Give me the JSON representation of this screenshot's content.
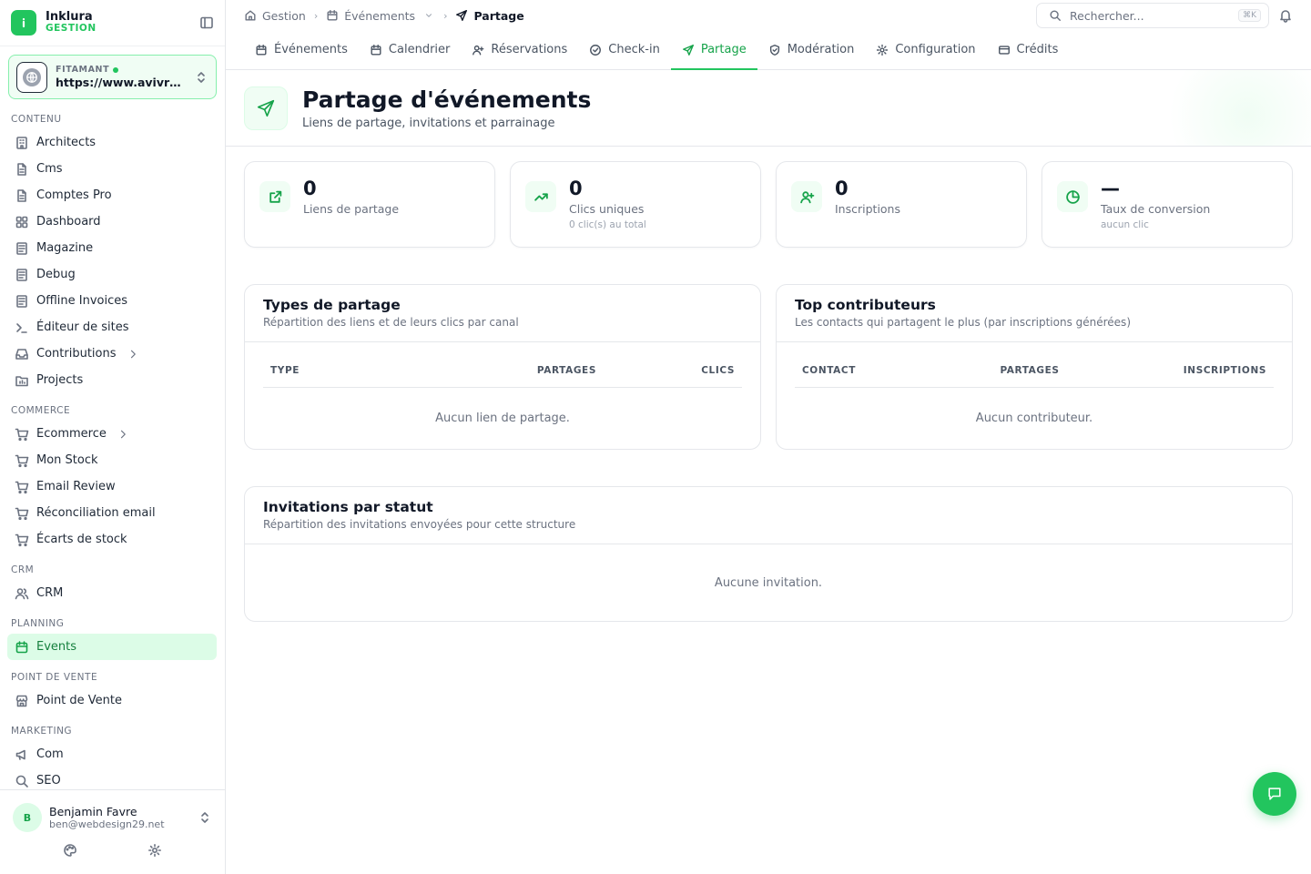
{
  "brand": {
    "name": "Inklura",
    "sub": "GESTION"
  },
  "site": {
    "label": "FITAMANT",
    "url": "https://www.avivrance.fr"
  },
  "nav": {
    "sections": [
      {
        "title": "CONTENU",
        "items": [
          {
            "label": "Architects"
          },
          {
            "label": "Cms"
          },
          {
            "label": "Comptes Pro"
          },
          {
            "label": "Dashboard"
          },
          {
            "label": "Magazine"
          },
          {
            "label": "Debug"
          },
          {
            "label": "Offline Invoices"
          },
          {
            "label": "Éditeur de sites"
          },
          {
            "label": "Contributions"
          },
          {
            "label": "Projects"
          }
        ]
      },
      {
        "title": "COMMERCE",
        "items": [
          {
            "label": "Ecommerce"
          },
          {
            "label": "Mon Stock"
          },
          {
            "label": "Email Review"
          },
          {
            "label": "Réconciliation email"
          },
          {
            "label": "Écarts de stock"
          }
        ]
      },
      {
        "title": "CRM",
        "items": [
          {
            "label": "CRM"
          }
        ]
      },
      {
        "title": "PLANNING",
        "items": [
          {
            "label": "Events"
          }
        ]
      },
      {
        "title": "POINT DE VENTE",
        "items": [
          {
            "label": "Point de Vente"
          }
        ]
      },
      {
        "title": "MARKETING",
        "items": [
          {
            "label": "Com"
          },
          {
            "label": "SEO"
          }
        ]
      }
    ]
  },
  "user": {
    "initial": "B",
    "name": "Benjamin Favre",
    "email": "ben@webdesign29.net"
  },
  "breadcrumb": {
    "home": "Gestion",
    "section": "Événements",
    "current": "Partage"
  },
  "search": {
    "placeholder": "Rechercher...",
    "shortcut": "⌘K"
  },
  "tabs": [
    {
      "label": "Événements"
    },
    {
      "label": "Calendrier"
    },
    {
      "label": "Réservations"
    },
    {
      "label": "Check-in"
    },
    {
      "label": "Partage"
    },
    {
      "label": "Modération"
    },
    {
      "label": "Configuration"
    },
    {
      "label": "Crédits"
    }
  ],
  "page": {
    "title": "Partage d'événements",
    "subtitle": "Liens de partage, invitations et parrainage"
  },
  "stats": [
    {
      "value": "0",
      "label": "Liens de partage",
      "sub": ""
    },
    {
      "value": "0",
      "label": "Clics uniques",
      "sub": "0 clic(s) au total"
    },
    {
      "value": "0",
      "label": "Inscriptions",
      "sub": ""
    },
    {
      "value": "—",
      "label": "Taux de conversion",
      "sub": "aucun clic"
    }
  ],
  "types": {
    "title": "Types de partage",
    "subtitle": "Répartition des liens et de leurs clics par canal",
    "columns": [
      "TYPE",
      "PARTAGES",
      "CLICS"
    ],
    "empty": "Aucun lien de partage."
  },
  "contributors": {
    "title": "Top contributeurs",
    "subtitle": "Les contacts qui partagent le plus (par inscriptions générées)",
    "columns": [
      "CONTACT",
      "PARTAGES",
      "INSCRIPTIONS"
    ],
    "empty": "Aucun contributeur."
  },
  "invitations": {
    "title": "Invitations par statut",
    "subtitle": "Répartition des invitations envoyées pour cette structure",
    "empty": "Aucune invitation."
  },
  "colors": {
    "accent": "#22c55e",
    "accent_dark": "#16a34a",
    "accent_soft": "#f0fdf4"
  }
}
